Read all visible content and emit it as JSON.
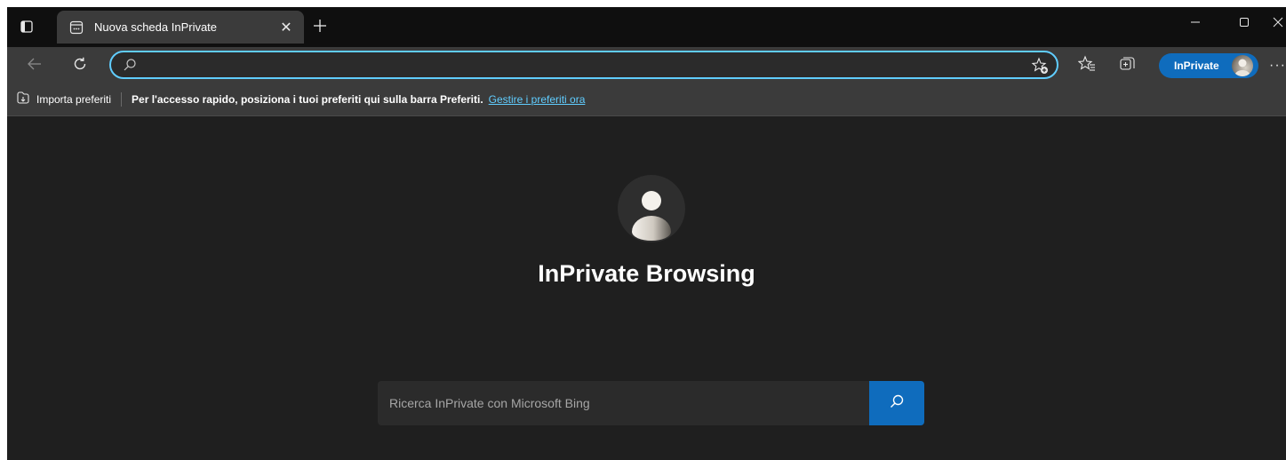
{
  "colors": {
    "accent": "#0f6cbd",
    "focus_ring": "#60cdff",
    "link": "#60cdff",
    "page_background": "#1f1f1f",
    "toolbar_background": "#3b3b3b"
  },
  "tabstrip": {
    "tab_actions_icon": "tab-actions-icon",
    "active_tab": {
      "icon": "inprivate-tab-icon",
      "title": "Nuova scheda InPrivate",
      "close_glyph": "✕"
    },
    "new_tab_icon": "plus-icon"
  },
  "window_controls": {
    "minimize_icon": "minimize-icon",
    "maximize_icon": "maximize-icon",
    "close_icon": "close-icon"
  },
  "toolbar": {
    "back_icon": "back-arrow-icon",
    "refresh_icon": "refresh-icon",
    "address_value": "",
    "address_icon": "search-icon",
    "add_favorite_icon": "add-favorite-icon",
    "favorites_icon": "favorites-icon",
    "collections_icon": "collections-icon",
    "profile_label": "InPrivate",
    "more_label": "···"
  },
  "favorites_bar": {
    "import_label": "Importa preferiti",
    "hint_text": "Per l'accesso rapido, posiziona i tuoi preferiti qui sulla barra Preferiti.",
    "manage_link": "Gestire i preferiti ora"
  },
  "main": {
    "title": "InPrivate Browsing",
    "search_placeholder": "Ricerca InPrivate con Microsoft Bing",
    "search_value": "",
    "search_icon": "search-icon"
  }
}
